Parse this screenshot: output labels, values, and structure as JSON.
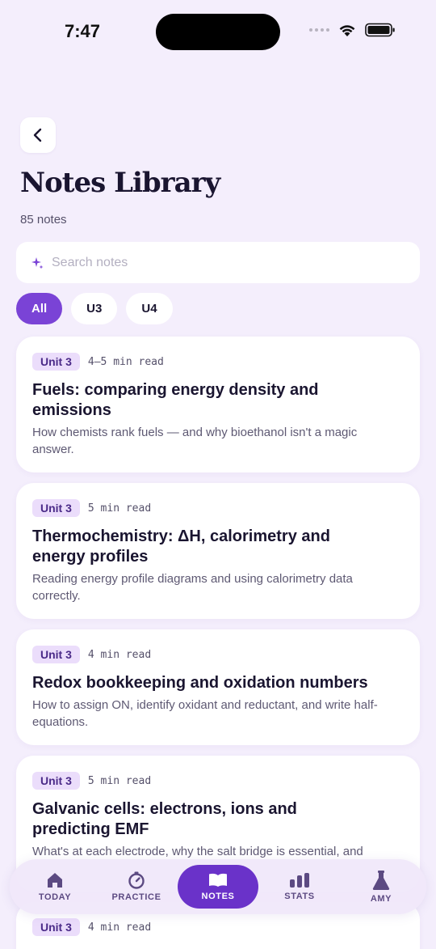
{
  "status": {
    "time": "7:47"
  },
  "header": {
    "title": "Notes Library",
    "count": "85 notes"
  },
  "search": {
    "placeholder": "Search notes"
  },
  "filters": {
    "all": "All",
    "u3": "U3",
    "u4": "U4"
  },
  "notes": [
    {
      "unit": "Unit 3",
      "read": "4–5 min read",
      "title": "Fuels: comparing energy density and emissions",
      "desc": "How chemists rank fuels — and why bioethanol isn't a magic answer."
    },
    {
      "unit": "Unit 3",
      "read": "5 min read",
      "title": "Thermochemistry: ΔH, calorimetry and energy profiles",
      "desc": "Reading energy profile diagrams and using calorimetry data correctly."
    },
    {
      "unit": "Unit 3",
      "read": "4 min read",
      "title": "Redox bookkeeping and oxidation numbers",
      "desc": "How to assign ON, identify oxidant and reductant, and write half-equations."
    },
    {
      "unit": "Unit 3",
      "read": "5 min read",
      "title": "Galvanic cells: electrons, ions and predicting EMF",
      "desc": "What's at each electrode, why the salt bridge is essential, and"
    },
    {
      "unit": "Unit 3",
      "read": "4 min read",
      "title": "",
      "desc": ""
    }
  ],
  "tabs": {
    "today": "TODAY",
    "practice": "PRACTICE",
    "notes": "NOTES",
    "stats": "STATS",
    "amy": "AMY"
  },
  "colors": {
    "accent": "#7A43D6",
    "background": "#F4EEFC",
    "badge": "#EBDDFB"
  }
}
